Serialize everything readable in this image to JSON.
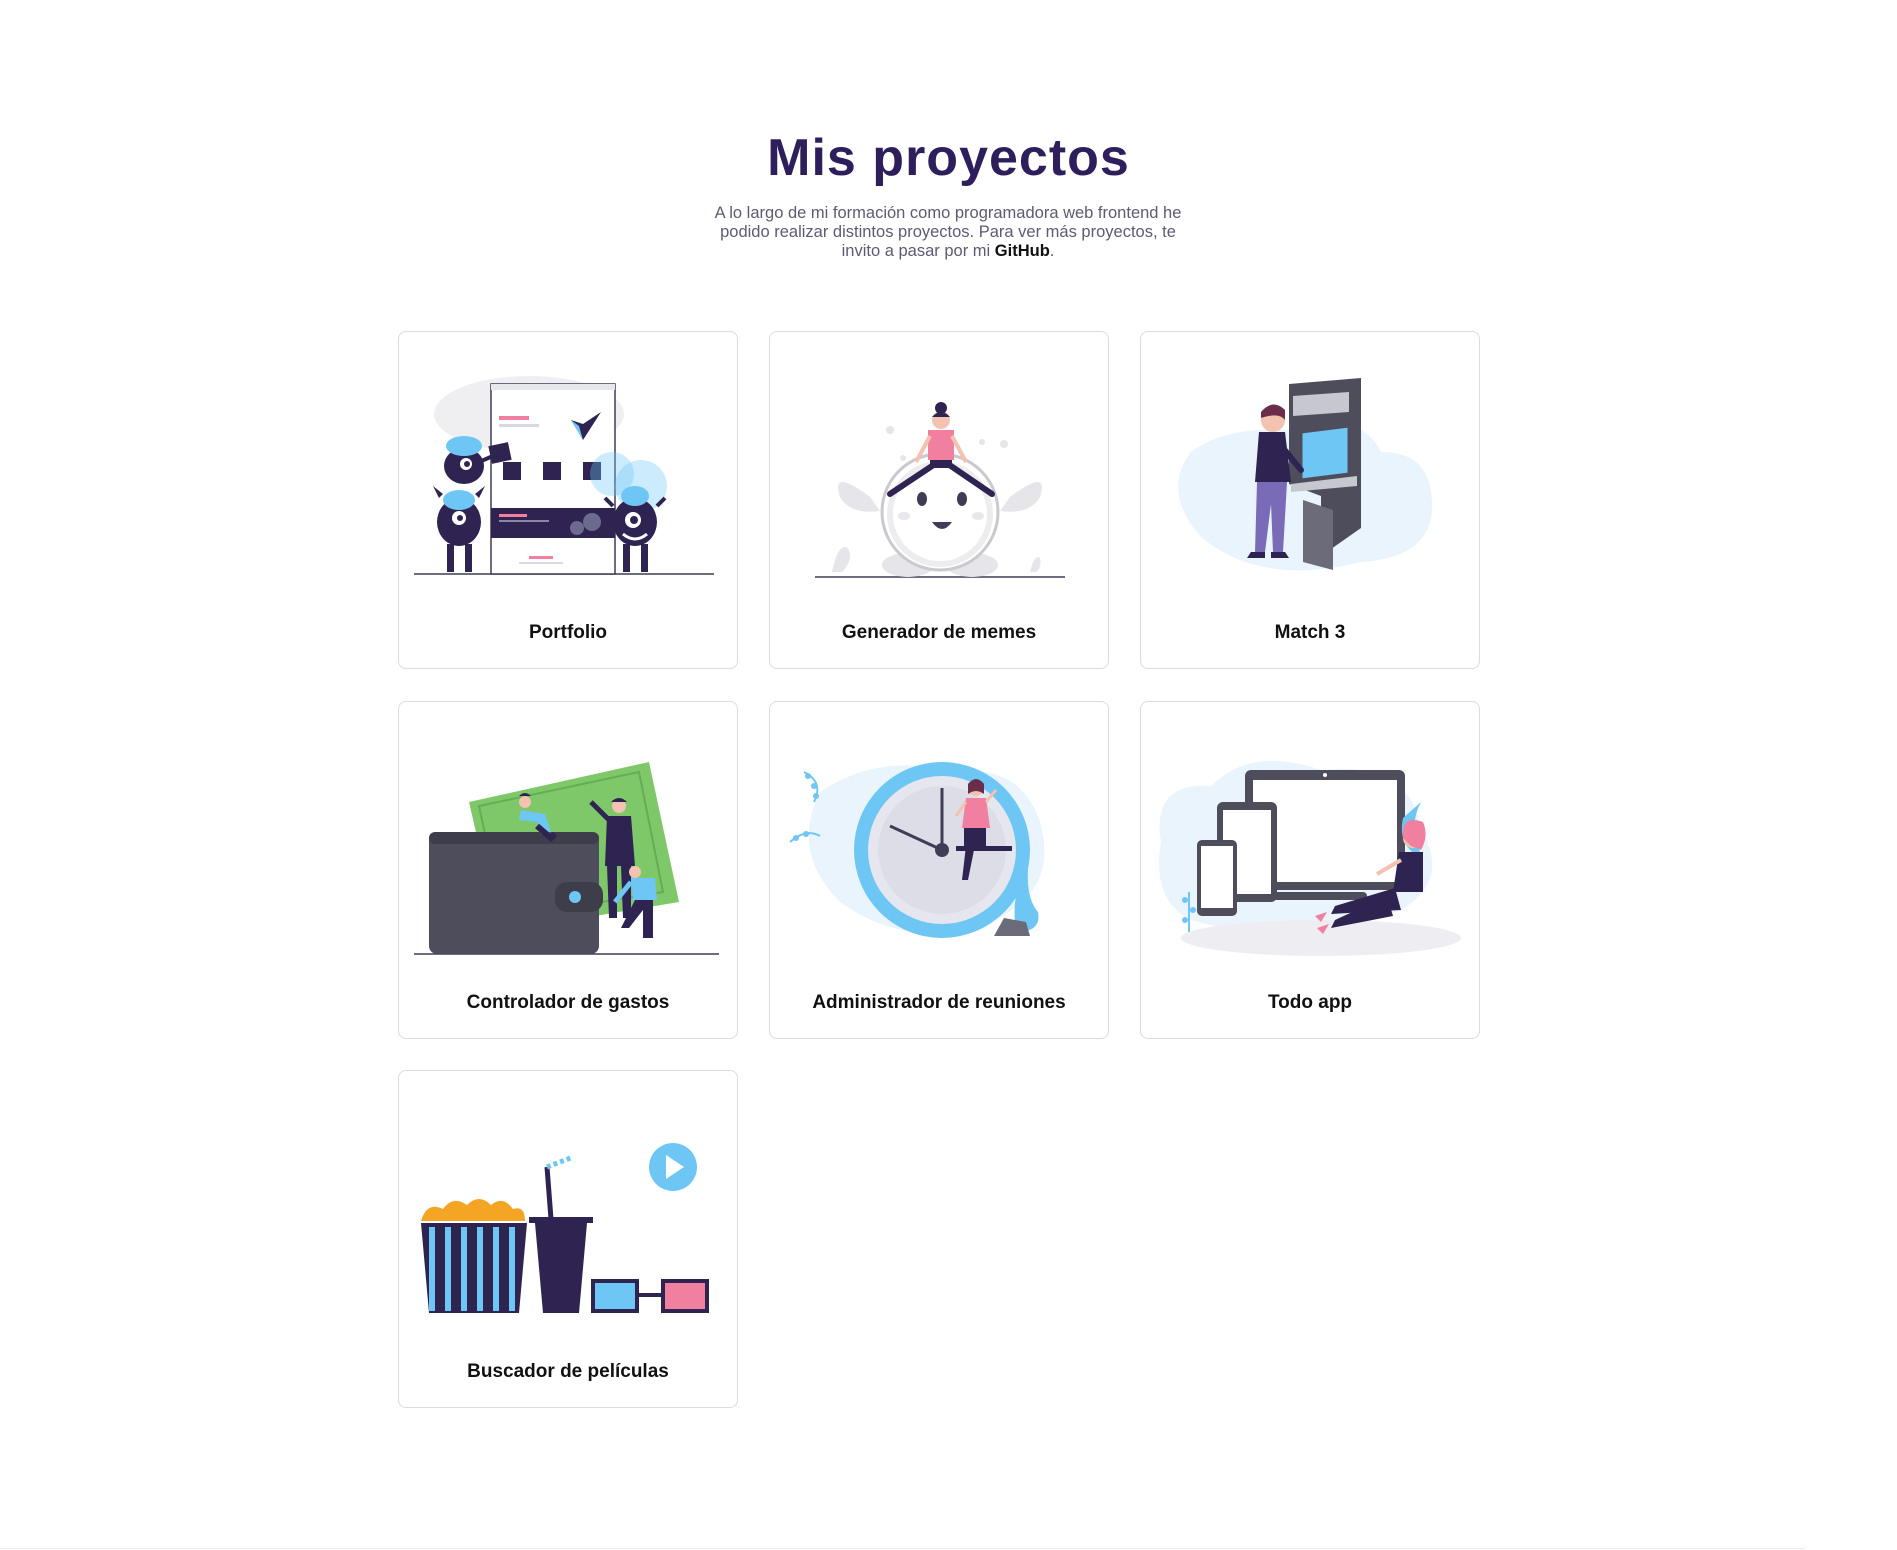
{
  "header": {
    "title": "Mis proyectos",
    "intro_text": "A lo largo de mi formación como programadora web frontend he podido realizar distintos proyectos. Para ver más proyectos, te invito a pasar por mi ",
    "github_label": "GitHub",
    "intro_end": "."
  },
  "projects": [
    {
      "title": "Portfolio",
      "illustration": "website-with-monsters-illustration"
    },
    {
      "title": "Generador de memes",
      "illustration": "girl-on-smiling-ball-illustration"
    },
    {
      "title": "Match 3",
      "illustration": "arcade-machine-player-illustration"
    },
    {
      "title": "Controlador de gastos",
      "illustration": "wallet-and-money-illustration"
    },
    {
      "title": "Administrador de reuniones",
      "illustration": "woman-on-clock-illustration"
    },
    {
      "title": "Todo app",
      "illustration": "devices-and-woman-illustration"
    },
    {
      "title": "Buscador de películas",
      "illustration": "popcorn-soda-3d-glasses-illustration"
    }
  ],
  "colors": {
    "title": "#2e1f5c",
    "accent_blue": "#6ec6f5",
    "accent_pink": "#f07fa0",
    "dark_purple": "#2f2451",
    "dark_gray": "#4e4d5c",
    "money_green": "#7ec86a",
    "popcorn_orange": "#f4a524"
  }
}
